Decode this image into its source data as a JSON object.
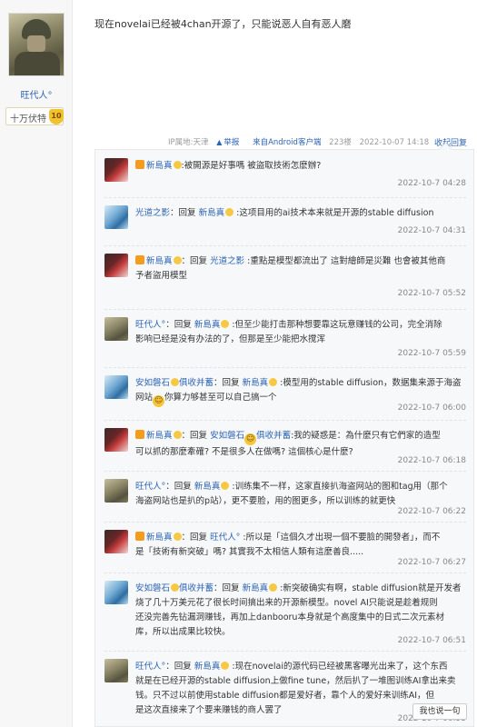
{
  "author": {
    "name": "旺代人°",
    "rank_title": "十万伏特",
    "level": "10"
  },
  "post": {
    "content": "现在novelai已经被4chan开源了，只能说恶人自有恶人磨",
    "ip": "IP属地:天津",
    "report": "举报",
    "client": "来自Android客户端",
    "floor": "223楼",
    "time": "2022-10-07 14:18",
    "fold_label": "收起回复"
  },
  "replies": [
    {
      "user": "新島真",
      "reply_to": "",
      "text": ":被開源是好事嗎 被盜取技術怎麽辦?",
      "text2": "",
      "time": "2022-10-7 04:28",
      "action": "回复"
    },
    {
      "user": "光道之影",
      "reply_to": "新島真",
      "text": ":这项目用的ai技术本来就是开源的stable diffusion",
      "text2": "",
      "time": "2022-10-7 04:31",
      "action": "回复"
    },
    {
      "user": "新島真",
      "reply_to": "光道之影",
      "text": ":重點是模型都流出了 這對繪師是災難 也會被其他商",
      "text2": "予者盜用模型",
      "time": "2022-10-7 05:52",
      "action": "回复"
    },
    {
      "user": "旺代人°",
      "reply_to": "新島真",
      "text": ":但至少能打击那种想要靠这玩意赚钱的公司，完全消除",
      "text2": "影响已经是没有办法的了，但那是至少能把水搅浑",
      "time": "2022-10-7 05:59",
      "action": "回复"
    },
    {
      "user": "安如磐石",
      "user2": "俱收并蓄",
      "reply_to": "新島真",
      "text": ":模型用的stable diffusion，数据集来源于海盗",
      "text2": "网站",
      "text2b": "你算力够甚至可以自己搞一个",
      "time": "2022-10-7 06:00",
      "action": "回复"
    },
    {
      "user": "新島真",
      "reply_to": "安如磐石",
      "reply_to2": "俱收并蓄",
      "text": ":我的疑惑是：為什麼只有它們家的造型",
      "text2": "可以抓的那麼牽確? 不是很多人在做嗎? 這個核心是什麼?",
      "time": "2022-10-7 06:18",
      "action": "回复"
    },
    {
      "user": "旺代人°",
      "reply_to": "新島真",
      "text": ":训练集不一样，这家直接扒海盗网站的图和tag用（那个",
      "text2": "海盗网站也是扒的p站），更不要脸，用的图更多，所以训练的就更快",
      "time": "2022-10-7 06:22",
      "action": "回复"
    },
    {
      "user": "新島真",
      "reply_to": "旺代人°",
      "text": ":所以是「這個久才出現一個不要臉的開發者」，而不",
      "text2": "是「技術有新突破」嗎? 其實我不太相信人類有這麼善良.....",
      "time": "2022-10-7 06:27",
      "action": "回复"
    },
    {
      "user": "安如磐石",
      "user2": "俱收并蓄",
      "reply_to": "新島真",
      "text": ":新突破确实有啊，stable diffusion就是开发者",
      "text2": "烧了几十万美元花了很长时间搞出来的开源新模型。novel AI只能说是趁着规则",
      "text3": "还没完善先钻漏洞赚钱，再加上danbooru本身就是个高度集中的日式二次元素材",
      "text4": "库，所以出成果比较快。",
      "time": "2022-10-7 06:51",
      "action": "回复"
    },
    {
      "user": "旺代人°",
      "reply_to": "新島真",
      "text": ":现在novelai的源代码已经被黑客曝光出来了，这个东西",
      "text2": "就是在已经开源的stable diffusion上做fine tune，然后扒了一堆图训练AI拿出来卖",
      "text3": "钱。只不过以前使用stable diffusion都是爱好者，靠个人的爱好来训练AI，但",
      "text4": "是这次直接来了个要来赚钱的商人罢了",
      "time": "2022-10-7 06:53",
      "action": "回复"
    }
  ],
  "say_button": "我也说一句",
  "colors": {
    "link": "#2d64b3",
    "meta": "#9a9a9a",
    "panel": "#f7f8fa"
  }
}
